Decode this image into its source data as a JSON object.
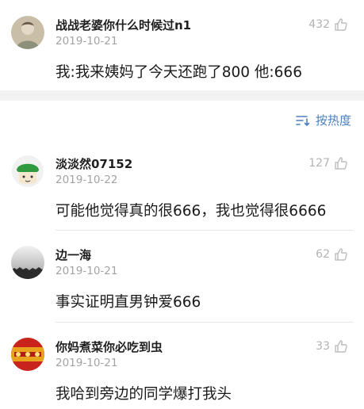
{
  "colors": {
    "accent": "#4c7fbf",
    "muted": "#a3a3a3",
    "separator_band": "#f2f2f2"
  },
  "top_comment": {
    "username": "战战老婆你什么时候过n1",
    "date": "2019-10-21",
    "likes": "432",
    "text": "我:我来姨妈了今天还跑了800 他:666",
    "like_icon": "thumbs-up-icon"
  },
  "sort_button": {
    "label": "按热度",
    "icon": "sort-icon"
  },
  "comments": [
    {
      "username": "淡淡然07152",
      "date": "2019-10-22",
      "likes": "127",
      "text": "可能他觉得真的很666，我也觉得很6666"
    },
    {
      "username": "边一海",
      "date": "2019-10-21",
      "likes": "62",
      "text": "事实证明直男钟爱666"
    },
    {
      "username": "你妈煮菜你必吃到虫",
      "date": "2019-10-21",
      "likes": "33",
      "text": "我哈到旁边的同学爆打我头"
    }
  ]
}
